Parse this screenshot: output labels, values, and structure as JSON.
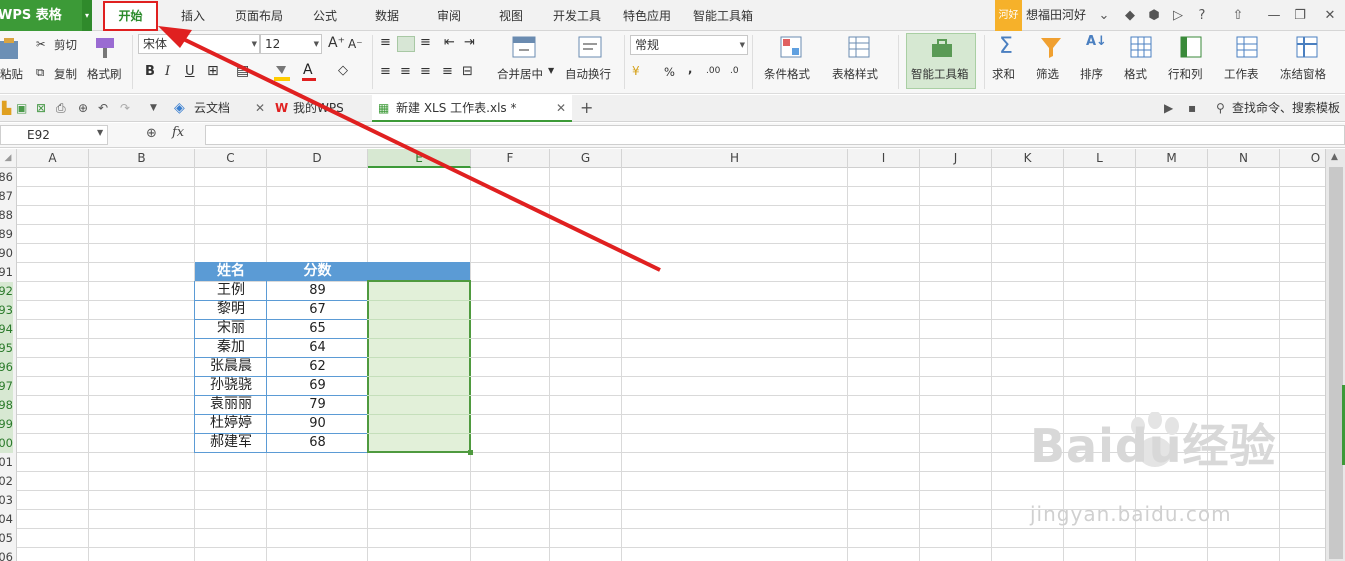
{
  "app": {
    "name": "WPS 表格"
  },
  "menu_tabs": [
    "开始",
    "插入",
    "页面布局",
    "公式",
    "数据",
    "审阅",
    "视图",
    "开发工具",
    "特色应用",
    "智能工具箱"
  ],
  "user": {
    "badge": "河好",
    "name": "想福田河好"
  },
  "ribbon": {
    "paste": "粘贴",
    "cut": "剪切",
    "copy": "复制",
    "format_painter": "格式刷",
    "font_name": "宋体",
    "font_size": "12",
    "bold": "B",
    "italic": "I",
    "underline": "U",
    "increase_font": "A⁺",
    "decrease_font": "A⁻",
    "merge_center": "合并居中",
    "wrap_text": "自动换行",
    "number_format": "常规",
    "percent": "%",
    "comma": ",",
    "dec_inc": ".00",
    "dec_dec": ".0",
    "conditional_format": "条件格式",
    "table_style": "表格样式",
    "smart_toolbox": "智能工具箱",
    "sum": "求和",
    "filter": "筛选",
    "sort": "排序",
    "format": "格式",
    "row_col": "行和列",
    "worksheet": "工作表",
    "freeze": "冻结窗格"
  },
  "doc_tabs": [
    {
      "label": "云文档"
    },
    {
      "label": "我的WPS"
    },
    {
      "label": "新建 XLS 工作表.xls *"
    }
  ],
  "search_command": "查找命令、搜索模板",
  "formula": {
    "name_box": "E92",
    "fx": "fx",
    "content": ""
  },
  "columns": [
    "A",
    "B",
    "C",
    "D",
    "E",
    "F",
    "G",
    "H",
    "I",
    "J",
    "K",
    "L",
    "M",
    "N",
    "O"
  ],
  "rows": [
    "86",
    "87",
    "88",
    "89",
    "90",
    "91",
    "92",
    "93",
    "94",
    "95",
    "96",
    "97",
    "98",
    "99",
    "100",
    "101",
    "102",
    "103",
    "104",
    "105",
    "106"
  ],
  "table": {
    "headers": [
      "姓名",
      "分数"
    ],
    "rows": [
      [
        "王例",
        "89"
      ],
      [
        "黎明",
        "67"
      ],
      [
        "宋丽",
        "65"
      ],
      [
        "秦加",
        "64"
      ],
      [
        "张晨晨",
        "62"
      ],
      [
        "孙骁骁",
        "69"
      ],
      [
        "袁丽丽",
        "79"
      ],
      [
        "杜婷婷",
        "90"
      ],
      [
        "郝建军",
        "68"
      ]
    ]
  },
  "watermark": {
    "brand": "Baidu经验",
    "url": "jingyan.baidu.com"
  },
  "colors": {
    "accent_green": "#3c9a37",
    "header_blue": "#5b9bd5",
    "selection_fill": "#e2f0d9",
    "annotation_red": "#e02020"
  }
}
